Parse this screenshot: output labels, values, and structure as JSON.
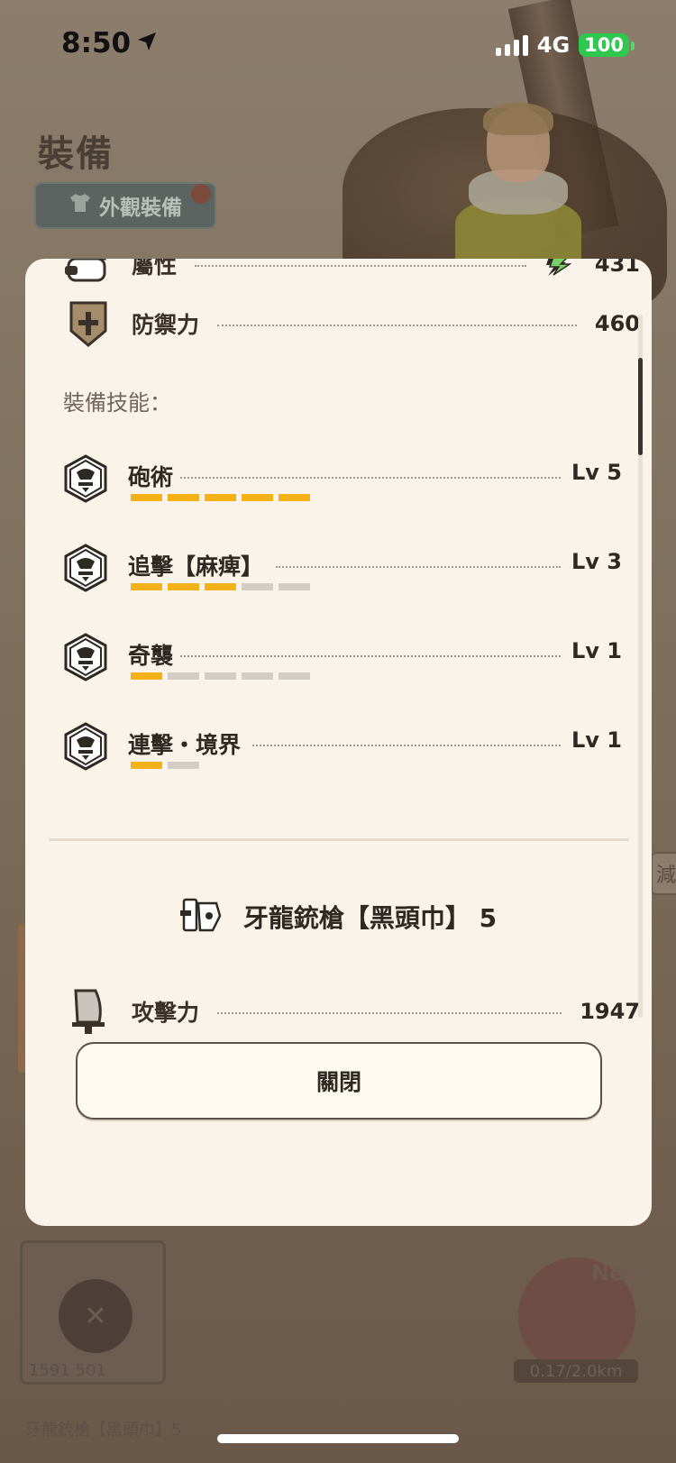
{
  "status_bar": {
    "time": "8:50",
    "network": "4G",
    "battery": "100",
    "icons": [
      "location-arrow-icon",
      "signal-bars-icon",
      "battery-icon"
    ]
  },
  "background": {
    "title": "裝備",
    "appearance_button": "外觀裝備",
    "card_stats": "1591  501",
    "card_label": "牙龍銃槍【黑頭巾】5",
    "new_label": "New",
    "distance": "0.17/2.0km",
    "side_tab": "減"
  },
  "modal": {
    "stats_top": [
      {
        "label": "屬性",
        "value": "431",
        "icon": "element-icon",
        "element_icon": "thunder-element-icon"
      },
      {
        "label": "防禦力",
        "value": "460",
        "icon": "shield-icon"
      }
    ],
    "skills_caption": "裝備技能：",
    "skills": [
      {
        "name": "砲術",
        "level": "Lv 5",
        "current": 5,
        "max": 5
      },
      {
        "name": "追擊【麻痺】",
        "level": "Lv 3",
        "current": 3,
        "max": 5
      },
      {
        "name": "奇襲",
        "level": "Lv 1",
        "current": 1,
        "max": 5
      },
      {
        "name": "連擊・境界",
        "level": "Lv 1",
        "current": 1,
        "max": 2
      }
    ],
    "weapon_name": "牙龍銃槍【黑頭巾】 5",
    "weapon_icon": "gunlance-icon",
    "attack": {
      "label": "攻擊力",
      "value": "1947",
      "icon": "sword-icon"
    },
    "close_label": "關閉"
  },
  "colors": {
    "panel_bg": "#faf3e9",
    "skill_bar_on": "#f5b11a",
    "skill_bar_off": "#d3cdc5",
    "battery_green": "#2ec84f"
  }
}
